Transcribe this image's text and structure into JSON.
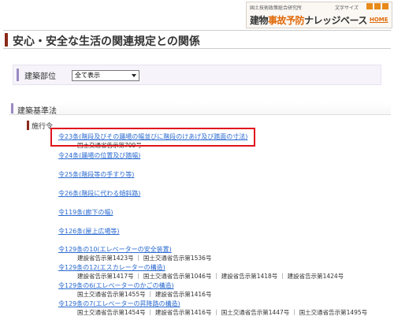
{
  "header": {
    "org": "国土技術政策総合研究所",
    "font_size_label": "文字サイズ",
    "title_prefix": "建物",
    "title_accent": "事故予防",
    "title_suffix": "ナレッジベース",
    "home_link": "HOME"
  },
  "page": {
    "title": "安心・安全な生活の関連規定との関係"
  },
  "filter": {
    "label": "建築部位",
    "selected": "全て表示"
  },
  "section": {
    "title": "建築基準法",
    "subsection_title": "施行令"
  },
  "entries": [
    {
      "link": "令23条(階段及びその踊場の幅並びに階段のけあげ及び踏面の寸法)",
      "refs": "国土交通省告示第709号"
    },
    {
      "link": "令24条(踊場の位置及び踏幅)",
      "refs": ""
    },
    {
      "link": "令25条(階段等の手すり等)",
      "refs": ""
    },
    {
      "link": "令26条(階段に代わる傾斜路)",
      "refs": ""
    },
    {
      "link": "令119条(廊下の幅)",
      "refs": ""
    },
    {
      "link": "令126条(屋上広場等)",
      "refs": ""
    },
    {
      "link": "令129条の10(エレベーターの安全装置)",
      "refs": "建設省告示第1423号 ｜ 国土交通省告示第1536号"
    },
    {
      "link": "令129条の12(エスカレーターの構造)",
      "refs": "建設省告示第1417号 ｜ 国土交通省告示第1046号 ｜ 建設省告示第1418号 ｜ 建設省告示第1424号"
    },
    {
      "link": "令129条の6(エレベーターのかごの構造)",
      "refs": "国土交通省告示第1455号 ｜ 建設省告示第1416号"
    },
    {
      "link": "令129条の7(エレベーターの昇降路の構造)",
      "refs": "国土交通省告示第1454号 ｜ 建設省告示第1416号 ｜ 国土交通省告示第1447号 ｜ 国土交通省告示第1495号"
    }
  ]
}
